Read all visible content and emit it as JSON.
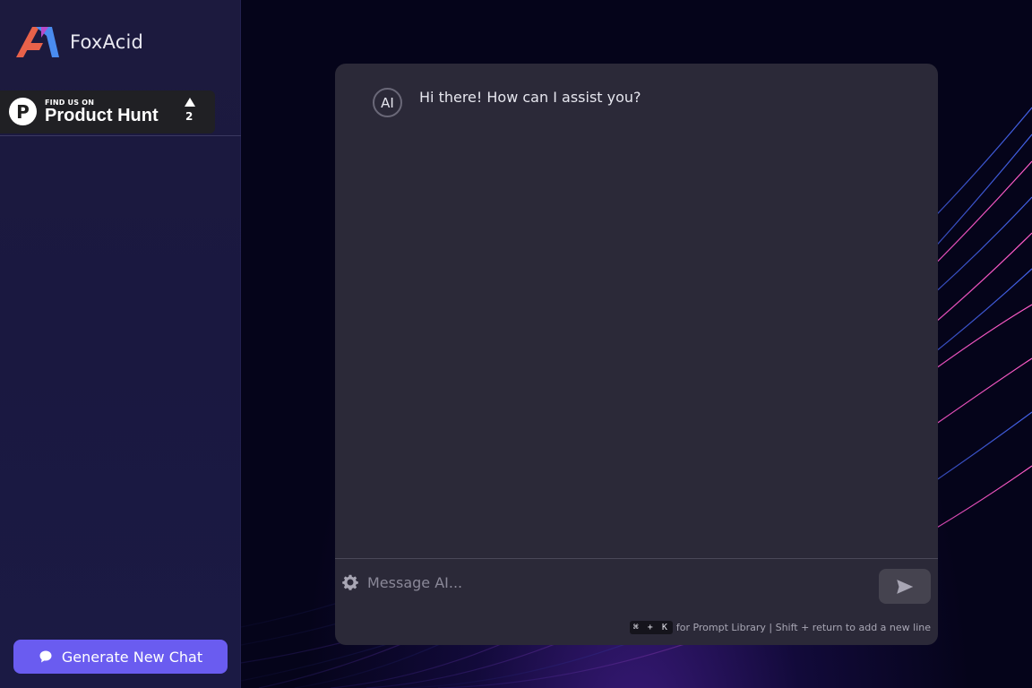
{
  "brand": {
    "name": "FoxAcid"
  },
  "product_hunt": {
    "small_label": "FIND US ON",
    "big_label": "Product Hunt",
    "letter": "P",
    "upvote_count": "2"
  },
  "sidebar": {
    "new_chat_label": "Generate New Chat"
  },
  "chat": {
    "messages": [
      {
        "avatar": "AI",
        "text": "Hi there! How can I assist you?"
      }
    ],
    "input_placeholder": "Message AI...",
    "shortcut_keys": "⌘ + K",
    "hint_text": "for Prompt Library | Shift + return to add a new line"
  },
  "icons": {
    "settings": "gear-icon",
    "send": "send-icon",
    "new_chat": "chat-bubble-icon"
  },
  "colors": {
    "accent": "#6a5cf0",
    "panel": "#2b2938",
    "sidebar": "#1c1a3e"
  }
}
